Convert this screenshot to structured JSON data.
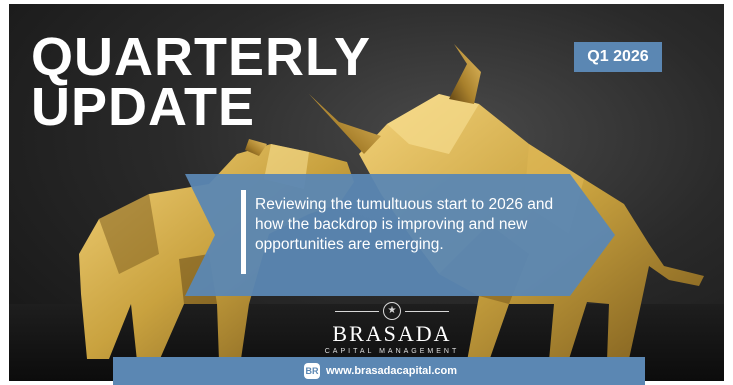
{
  "header": {
    "title_line1": "QUARTERLY",
    "title_line2": "UPDATE",
    "badge": "Q1 2026"
  },
  "banner": {
    "text": "Reviewing the tumultuous start to 2026 and how the backdrop is improving and new opportunities are emerging."
  },
  "logo": {
    "name": "BRASADA",
    "subtitle": "CAPITAL MANAGEMENT",
    "star_icon": "star-icon"
  },
  "footer": {
    "icon": "web-icon",
    "url": "www.brasadacapital.com"
  },
  "colors": {
    "accent": "#5b87b3",
    "gold": "#c9a23f",
    "background": "#1e1e1e"
  }
}
